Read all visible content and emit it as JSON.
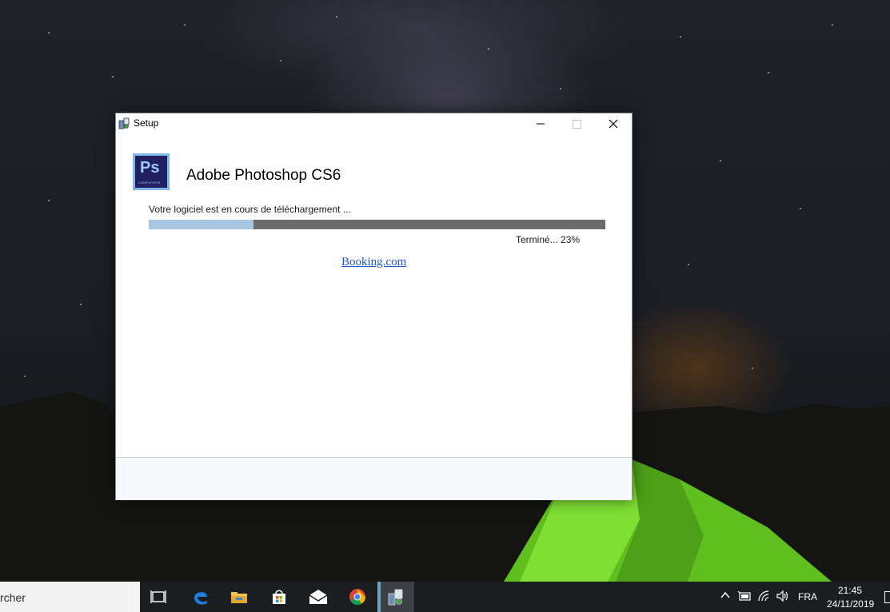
{
  "window": {
    "title": "Setup",
    "product_name": "Adobe Photoshop CS6",
    "logo_letters": "Ps",
    "logo_subtext": "COMPUTERS",
    "status_text": "Votre logiciel est en cours de téléchargement ...",
    "progress_fraction": 0.23,
    "progress_text": "Terminé... 23%",
    "link_text": "Booking.com",
    "minimize_glyph": "—",
    "maximize_glyph": "☐",
    "close_glyph": "✕"
  },
  "taskbar": {
    "search_text": "rcher",
    "apps": [
      "task-view-icon",
      "edge-icon",
      "file-explorer-icon",
      "store-icon",
      "mail-icon",
      "chrome-icon",
      "setup-app-icon"
    ],
    "language": "FRA",
    "time": "21:45",
    "date": "24/11/2019"
  },
  "colors": {
    "progress_fill": "#a8c6df",
    "progress_track": "#6b6b6b",
    "link": "#1a56c2",
    "taskbar": "#1b1d21"
  }
}
